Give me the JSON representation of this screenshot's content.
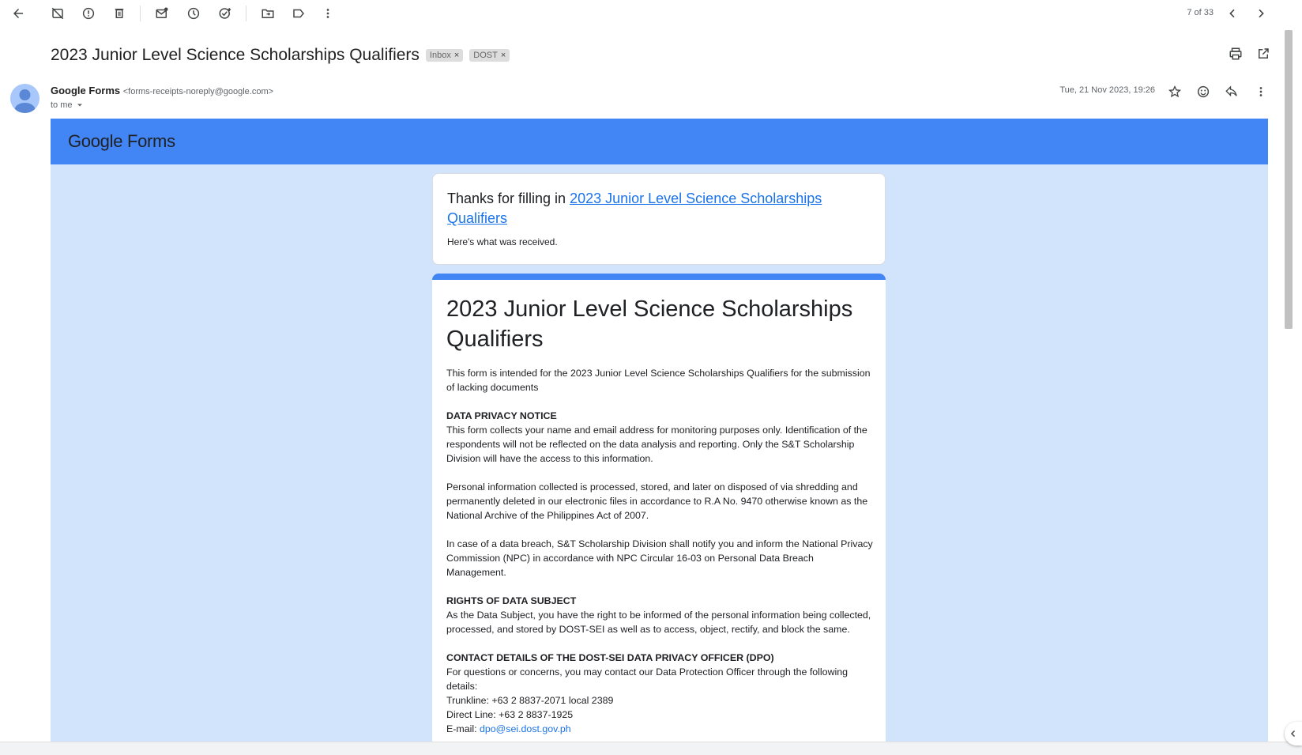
{
  "toolbar": {
    "buttons": [
      "back",
      "archive",
      "report-spam",
      "delete",
      "mark-unread",
      "snooze",
      "add-to-tasks",
      "move-to",
      "labels",
      "more"
    ],
    "pager": "7 of 33"
  },
  "message": {
    "subject": "2023 Junior Level Science Scholarships Qualifiers",
    "labels": [
      "Inbox",
      "DOST"
    ],
    "sender_name": "Google Forms",
    "sender_email": "<forms-receipts-noreply@google.com>",
    "recipient": "to me",
    "date": "Tue, 21 Nov 2023, 19:26"
  },
  "email_body": {
    "logo_text": "Google Forms",
    "thanks_prefix": "Thanks for filling in ",
    "thanks_link": "2023 Junior Level Science Scholarships Qualifiers",
    "received": "Here's what was received.",
    "form_title": "2023 Junior Level Science Scholarships Qualifiers",
    "intro": "This form is intended for the 2023 Junior Level Science Scholarships Qualifiers for the submission of lacking documents",
    "privacy_heading": "DATA PRIVACY NOTICE",
    "privacy_p1": "This form collects your name and email address for monitoring purposes only. Identification of the respondents will not be reflected on the data analysis and reporting. Only the S&T Scholarship Division will have the access to this information.",
    "privacy_p2": "Personal information collected is processed, stored, and later on disposed of via shredding and permanently deleted in our electronic files in accordance to R.A No. 9470 otherwise known as the National Archive of the Philippines Act of 2007.",
    "privacy_p3": "In case of a data breach,  S&T Scholarship Division shall notify you and inform the National Privacy Commission (NPC) in accordance with NPC Circular 16-03 on Personal Data Breach Management.",
    "rights_heading": "RIGHTS OF DATA SUBJECT",
    "rights_p": "As the Data Subject, you have the right to be informed of the personal information being collected, processed, and stored by DOST-SEI as well as to access, object, rectify, and block the same.",
    "contact_heading": "CONTACT DETAILS OF THE DOST-SEI DATA PRIVACY OFFICER (DPO)",
    "contact_p": "For questions or concerns, you may contact our Data Protection Officer through the following details:",
    "trunkline": "Trunkline: +63 2 8837-2071 local 2389",
    "direct_line": "Direct Line: +63 2 8837-1925",
    "email_label": "E-mail: ",
    "email_link": "dpo@sei.dost.gov.ph"
  },
  "colors": {
    "banner": "#4285f4",
    "body_background": "#d2e3fc",
    "link": "#1a73e8"
  }
}
